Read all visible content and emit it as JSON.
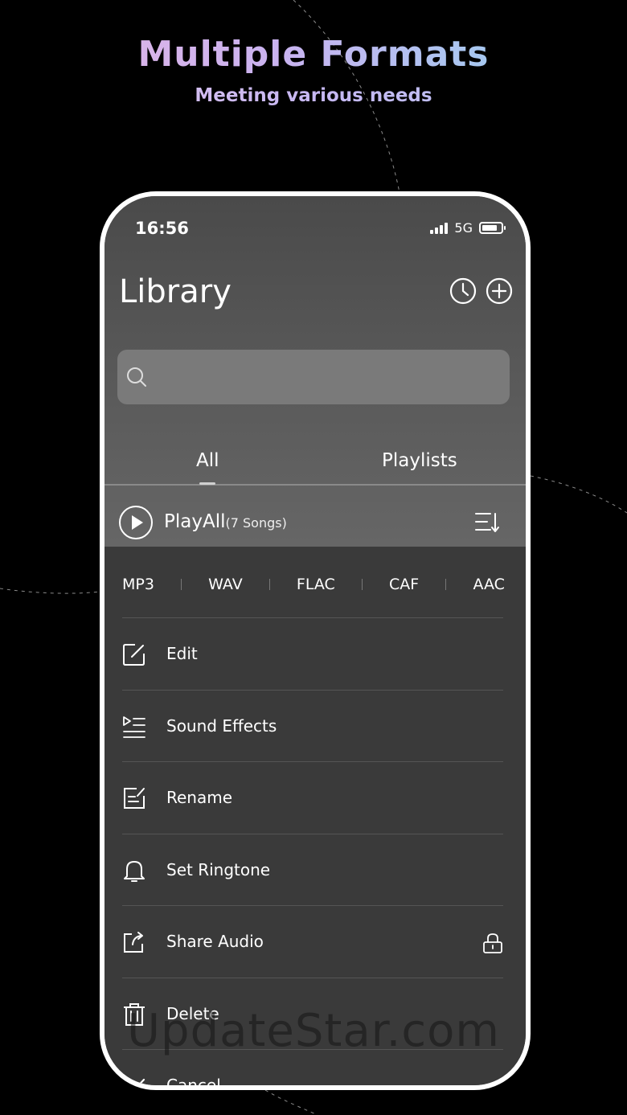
{
  "promo": {
    "headline": "Multiple Formats",
    "subline": "Meeting various needs"
  },
  "status_bar": {
    "time": "16:56",
    "network": "5G",
    "icons": [
      "signal-icon",
      "battery-icon"
    ]
  },
  "header": {
    "title": "Library",
    "buttons": [
      {
        "name": "history",
        "icon": "clock-icon"
      },
      {
        "name": "add",
        "icon": "plus-circle-icon"
      }
    ]
  },
  "search": {
    "placeholder": "",
    "icon": "search-icon"
  },
  "tabs": [
    {
      "label": "All",
      "selected": true
    },
    {
      "label": "Playlists",
      "selected": false
    }
  ],
  "playall": {
    "label": "PlayAll",
    "count": "(7 Songs)",
    "icons": [
      "play-circle-icon",
      "sort-icon"
    ]
  },
  "formats": [
    "MP3",
    "WAV",
    "FLAC",
    "CAF",
    "AAC"
  ],
  "menu": [
    {
      "label": "Edit",
      "icon": "edit-icon"
    },
    {
      "label": "Sound Effects",
      "icon": "sound-effects-icon"
    },
    {
      "label": "Rename",
      "icon": "rename-icon"
    },
    {
      "label": "Set Ringtone",
      "icon": "bell-icon"
    },
    {
      "label": "Share Audio",
      "icon": "share-icon",
      "locked": true
    },
    {
      "label": "Delete",
      "icon": "trash-icon"
    },
    {
      "label": "Cancel",
      "icon": "check-icon"
    }
  ],
  "watermark": "UpdateStar.com",
  "colors": {
    "background": "#000000",
    "sheet": "#3a3a3a",
    "search_field": "#7a7a7a",
    "headline_gradient": [
      "#e6b4e3",
      "#8fd6f0"
    ]
  }
}
